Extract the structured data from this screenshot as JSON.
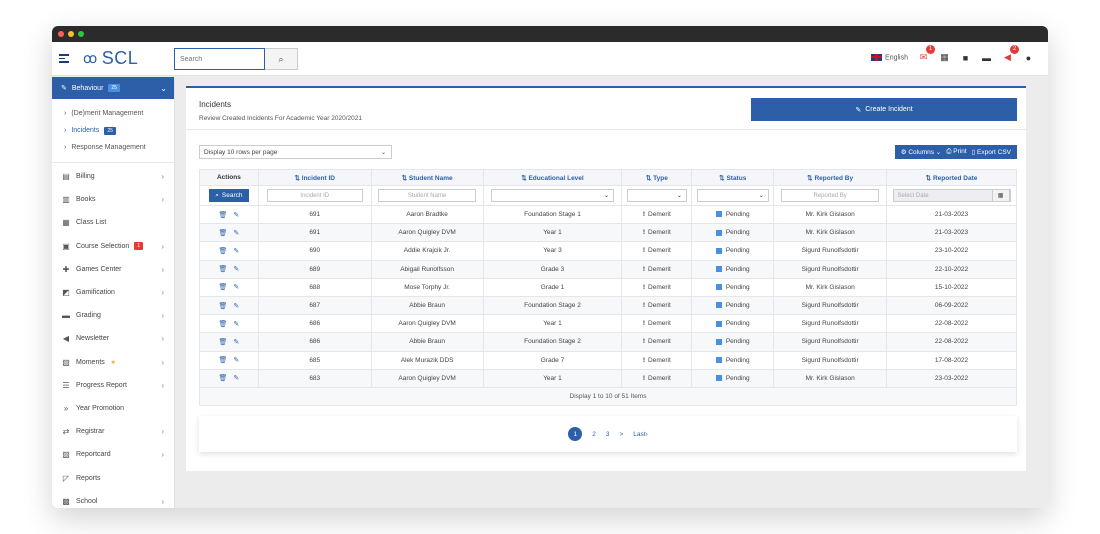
{
  "app": {
    "logo_text": "SCL"
  },
  "search": {
    "placeholder": "Search"
  },
  "topbar": {
    "language": "English",
    "mail_badge": "1",
    "alerts_badge": "2"
  },
  "colors": {
    "accent": "#2c5fa8",
    "danger": "#e53935",
    "status_pending": "#4a90e2"
  },
  "sidebar": {
    "active": {
      "label": "Behaviour",
      "badge": "25"
    },
    "subitems": [
      {
        "label": "(De)merit Management",
        "badge": ""
      },
      {
        "label": "Incidents",
        "badge": "25"
      },
      {
        "label": "Response Management",
        "badge": ""
      }
    ],
    "items": [
      {
        "label": "Billing",
        "icon": "billing-icon",
        "glyph": "▤"
      },
      {
        "label": "Books",
        "icon": "books-icon",
        "glyph": "▥"
      },
      {
        "label": "Class List",
        "icon": "class-list-icon",
        "glyph": "▦"
      },
      {
        "label": "Course Selection",
        "icon": "course-icon",
        "glyph": "▣",
        "badge": "1"
      },
      {
        "label": "Games Center",
        "icon": "games-icon",
        "glyph": "✚"
      },
      {
        "label": "Gamification",
        "icon": "gamification-icon",
        "glyph": "◩"
      },
      {
        "label": "Grading",
        "icon": "grading-icon",
        "glyph": "▬"
      },
      {
        "label": "Newsletter",
        "icon": "newsletter-icon",
        "glyph": "◀"
      },
      {
        "label": "Moments",
        "icon": "moments-icon",
        "glyph": "▧",
        "star": "✶"
      },
      {
        "label": "Progress Report",
        "icon": "progress-icon",
        "glyph": "☰"
      },
      {
        "label": "Year Promotion",
        "icon": "promotion-icon",
        "glyph": "»"
      },
      {
        "label": "Registrar",
        "icon": "registrar-icon",
        "glyph": "⇄"
      },
      {
        "label": "Reportcard",
        "icon": "reportcard-icon",
        "glyph": "▨"
      },
      {
        "label": "Reports",
        "icon": "reports-icon",
        "glyph": "◸"
      },
      {
        "label": "School",
        "icon": "school-icon",
        "glyph": "▩"
      }
    ]
  },
  "page": {
    "title": "Incidents",
    "subtitle": "Review Created Incidents For Academic Year 2020/2021",
    "create_label": "Create Incident",
    "rows_per_page": "Display 10 rows per page",
    "columns_label": "Columns",
    "print_label": "Print",
    "export_label": "Export CSV"
  },
  "table": {
    "headers": [
      "Actions",
      "Incident ID",
      "Student Name",
      "Educational Level",
      "Type",
      "Status",
      "Reported By",
      "Reported Date"
    ],
    "search_label": "Search",
    "filters": {
      "incident_id": "Incident ID",
      "student_name": "Student Name",
      "reported_by": "Reported By",
      "reported_date": "Select Date"
    },
    "rows": [
      {
        "id": "691",
        "student": "Aaron Bradtke",
        "level": "Foundation Stage 1",
        "type": "Demerit",
        "status": "Pending",
        "reporter": "Mr. Kirk Gislason",
        "date": "21-03-2023"
      },
      {
        "id": "691",
        "student": "Aaron Quigley DVM",
        "level": "Year 1",
        "type": "Demerit",
        "status": "Pending",
        "reporter": "Mr. Kirk Gislason",
        "date": "21-03-2023"
      },
      {
        "id": "690",
        "student": "Addie Krajcik Jr.",
        "level": "Year 3",
        "type": "Demerit",
        "status": "Pending",
        "reporter": "Sigurd Runolfsdottir",
        "date": "23-10-2022"
      },
      {
        "id": "689",
        "student": "Abigail Runolfsson",
        "level": "Grade 3",
        "type": "Demerit",
        "status": "Pending",
        "reporter": "Sigurd Runolfsdottir",
        "date": "22-10-2022"
      },
      {
        "id": "688",
        "student": "Mose Torphy Jr.",
        "level": "Grade 1",
        "type": "Demerit",
        "status": "Pending",
        "reporter": "Mr. Kirk Gislason",
        "date": "15-10-2022"
      },
      {
        "id": "687",
        "student": "Abbie Braun",
        "level": "Foundation Stage 2",
        "type": "Demerit",
        "status": "Pending",
        "reporter": "Sigurd Runolfsdottir",
        "date": "06-09-2022"
      },
      {
        "id": "686",
        "student": "Aaron Quigley DVM",
        "level": "Year 1",
        "type": "Demerit",
        "status": "Pending",
        "reporter": "Sigurd Runolfsdottir",
        "date": "22-08-2022"
      },
      {
        "id": "686",
        "student": "Abbie Braun",
        "level": "Foundation Stage 2",
        "type": "Demerit",
        "status": "Pending",
        "reporter": "Sigurd Runolfsdottir",
        "date": "22-08-2022"
      },
      {
        "id": "685",
        "student": "Alek Murazik DDS",
        "level": "Grade 7",
        "type": "Demerit",
        "status": "Pending",
        "reporter": "Sigurd Runolfsdottir",
        "date": "17-08-2022"
      },
      {
        "id": "683",
        "student": "Aaron Quigley DVM",
        "level": "Year 1",
        "type": "Demerit",
        "status": "Pending",
        "reporter": "Mr. Kirk Gislason",
        "date": "23-03-2022"
      }
    ],
    "footer": "Display 1 to 10 of 51 Items"
  },
  "pagination": {
    "pages": [
      "1",
      "2",
      "3"
    ],
    "next": ">",
    "last": "Last›"
  }
}
